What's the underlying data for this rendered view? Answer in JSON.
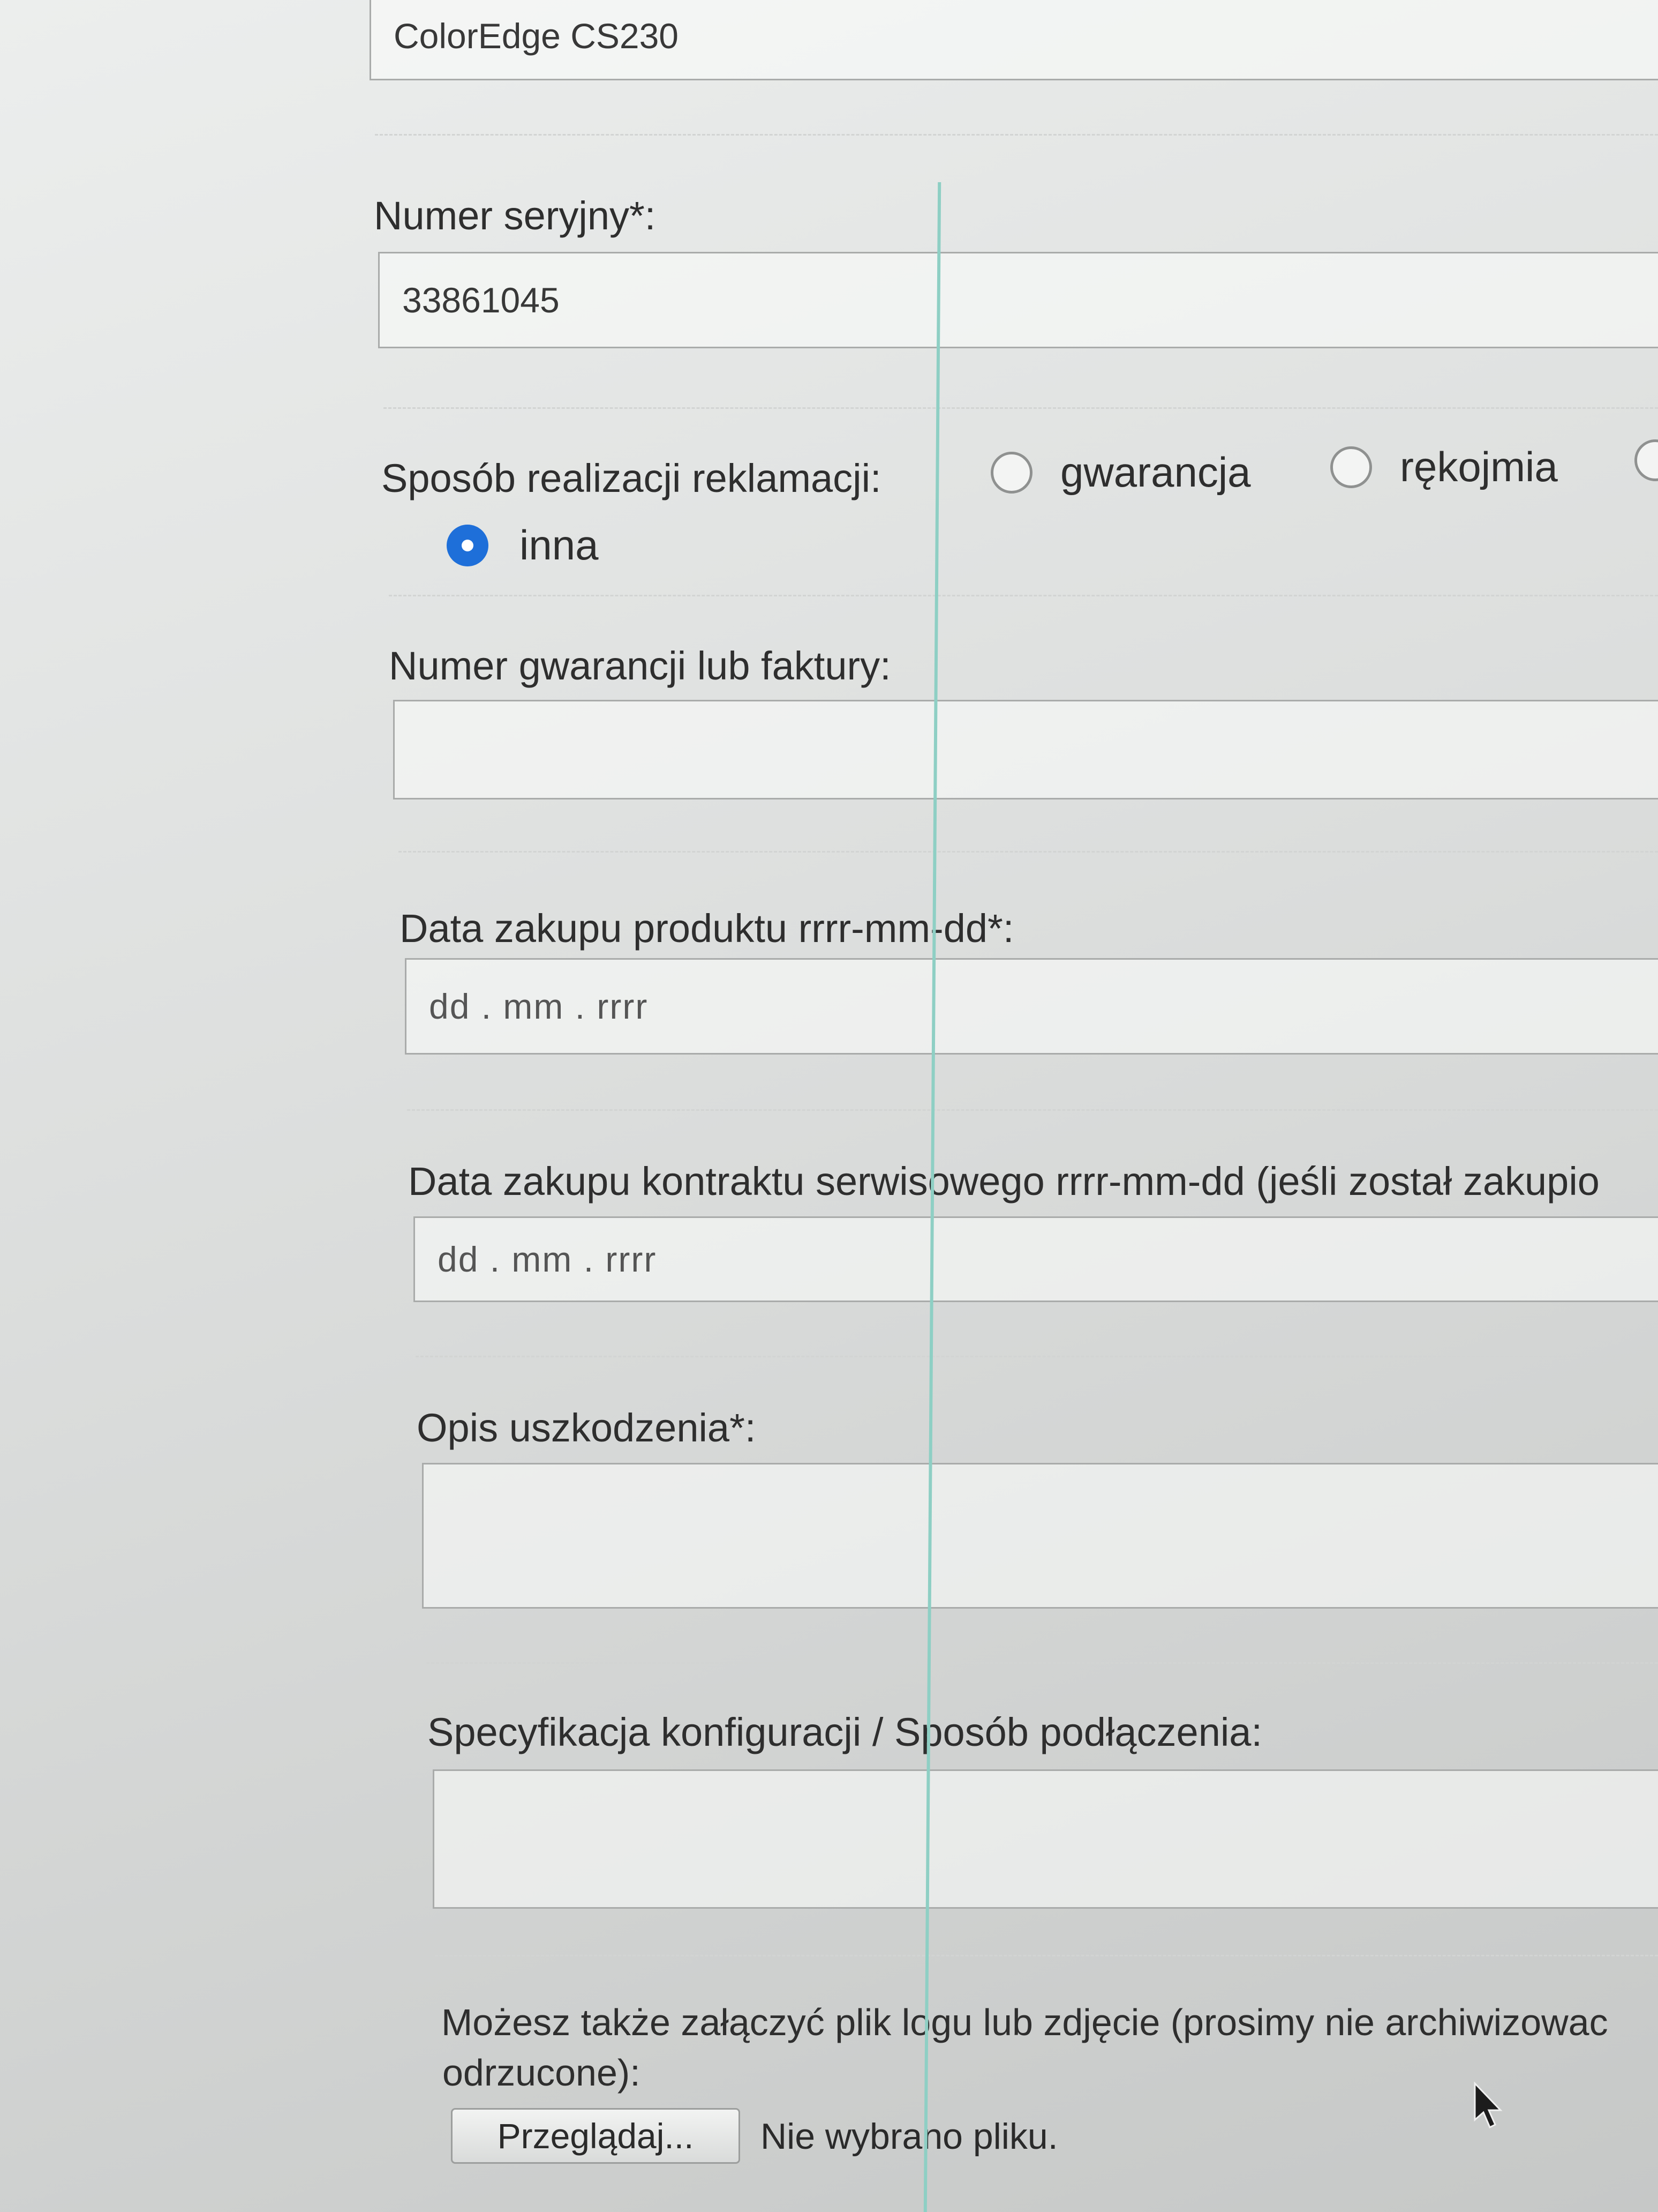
{
  "form": {
    "model_field": {
      "value": "ColorEdge CS230"
    },
    "serial": {
      "label": "Numer seryjny*:",
      "value": "33861045"
    },
    "claim_method": {
      "label": "Sposób realizacji reklamacji:",
      "options": [
        {
          "label": "gwarancja",
          "checked": false
        },
        {
          "label": "rękojmia",
          "checked": false
        },
        {
          "label": "inna",
          "checked": true
        }
      ]
    },
    "warranty_number": {
      "label": "Numer gwarancji lub faktury:",
      "value": ""
    },
    "purchase_date": {
      "label": "Data zakupu produktu rrrr-mm-dd*:",
      "placeholder": "dd . mm . rrrr"
    },
    "contract_date": {
      "label": "Data zakupu kontraktu serwisowego rrrr-mm-dd (jeśli został zakupio",
      "placeholder": "dd . mm . rrrr"
    },
    "damage_description": {
      "label": "Opis uszkodzenia*:",
      "value": ""
    },
    "configuration": {
      "label": "Specyfikacja konfiguracji / Sposób podłączenia:",
      "value": ""
    },
    "attachment": {
      "text_line1": "Możesz także załączyć plik logu lub zdjęcie (prosimy nie archiwizowac",
      "text_line2": "odrzucone):",
      "browse_label": "Przeglądaj...",
      "status": "Nie wybrano pliku."
    }
  },
  "colors": {
    "radio_checked": "#1e6fd9",
    "background": "#e2e4e3",
    "input_border": "#a9abaa"
  },
  "icons": {
    "cursor": "mouse-pointer-icon"
  }
}
